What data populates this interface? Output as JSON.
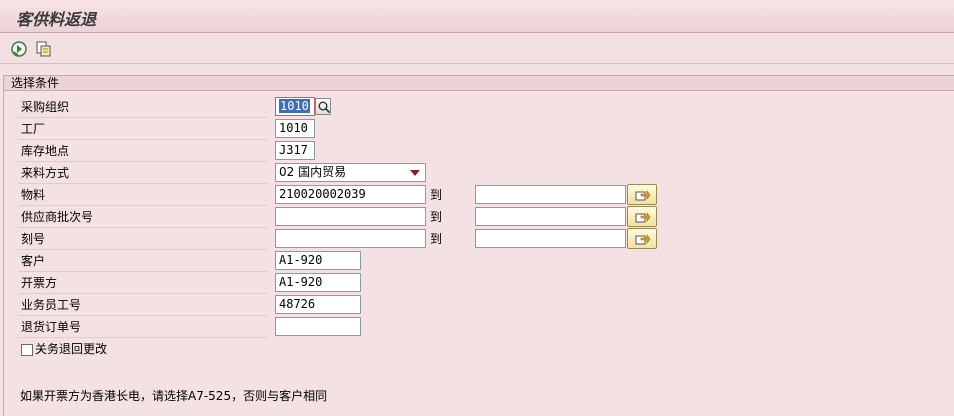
{
  "window": {
    "title": "客供料返退"
  },
  "toolbar": {
    "execute_icon": "execute-icon",
    "variant_icon": "get-variant-icon"
  },
  "selection": {
    "group_title": "选择条件",
    "to_label": "到",
    "rows": [
      {
        "label": "采购组织",
        "value": "1010"
      },
      {
        "label": "工厂",
        "value": "1010"
      },
      {
        "label": "库存地点",
        "value": "J317"
      },
      {
        "label": "来料方式",
        "value": "02 国内贸易"
      },
      {
        "label": "物料",
        "value": "210020002039",
        "to": ""
      },
      {
        "label": "供应商批次号",
        "value": "",
        "to": ""
      },
      {
        "label": "刻号",
        "value": "",
        "to": ""
      },
      {
        "label": "客户",
        "value": "A1-920"
      },
      {
        "label": "开票方",
        "value": "A1-920"
      },
      {
        "label": "业务员工号",
        "value": "48726"
      },
      {
        "label": "退货订单号",
        "value": ""
      }
    ],
    "checkbox_label": "关务退回更改",
    "checkbox_checked": false
  },
  "note": "如果开票方为香港长电，请选择A7-525，否则与客户相同"
}
